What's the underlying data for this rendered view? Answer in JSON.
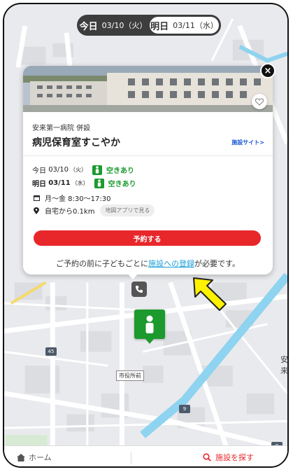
{
  "date_switch": {
    "today_label": "今日",
    "today_date": "03/10（火）",
    "tomorrow_label": "明日",
    "tomorrow_date": "03/11（水）"
  },
  "card": {
    "close_label": "×",
    "organization": "安来第一病院 併設",
    "facility_name": "病児保育室すこやか",
    "site_link": "施設サイト>",
    "availability": [
      {
        "label": "今日",
        "date": "03/10",
        "dow": "（火）",
        "status": "空きあり"
      },
      {
        "label": "明日",
        "date": "03/11",
        "dow": "（水）",
        "status": "空きあり"
      }
    ],
    "hours": "月〜金 8:30〜17:30",
    "distance": "自宅から0.1km",
    "map_app_button": "地図アプリで見る",
    "reserve_button": "予約する",
    "note_prefix": "ご予約の前に子どもごとに",
    "note_link": "施設への登録",
    "note_suffix": "が必要です。"
  },
  "map": {
    "city_hall_label": "市役所前",
    "route_45": "45",
    "route_9a": "9",
    "route_9b": "9",
    "area_label": "安来"
  },
  "bottom_nav": {
    "home_label": "ホーム",
    "search_label": "施設を探す"
  },
  "colors": {
    "accent_red": "#e8272b",
    "available_green": "#1c9a2e",
    "link_blue": "#1a9fd6",
    "arrow_yellow": "#fff200"
  }
}
